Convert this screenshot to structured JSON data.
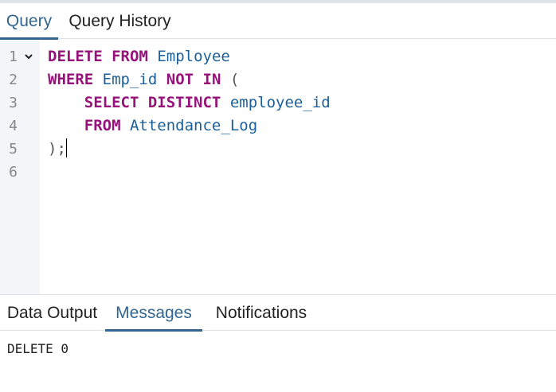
{
  "top_tabs": [
    {
      "label": "Query",
      "active": true
    },
    {
      "label": "Query History",
      "active": false
    }
  ],
  "editor": {
    "lines": [
      {
        "number": "1",
        "foldable": true
      },
      {
        "number": "2"
      },
      {
        "number": "3"
      },
      {
        "number": "4"
      },
      {
        "number": "5"
      },
      {
        "number": "6"
      }
    ],
    "tokens": {
      "delete": "DELETE",
      "from": "FROM",
      "employee": "Employee",
      "where": "WHERE",
      "emp_id": "Emp_id",
      "not": "NOT",
      "in": "IN",
      "open_paren": "(",
      "select": "SELECT",
      "distinct": "DISTINCT",
      "employee_id": "employee_id",
      "from2": "FROM",
      "attendance_log": "Attendance_Log",
      "close_paren": ");"
    }
  },
  "bottom_tabs": [
    {
      "label": "Data Output",
      "active": false
    },
    {
      "label": "Messages",
      "active": true
    },
    {
      "label": "Notifications",
      "active": false
    }
  ],
  "messages": {
    "result": "DELETE 0"
  },
  "colors": {
    "accent": "#326690",
    "keyword": "#97127a",
    "identifier": "#1b5f9a"
  }
}
